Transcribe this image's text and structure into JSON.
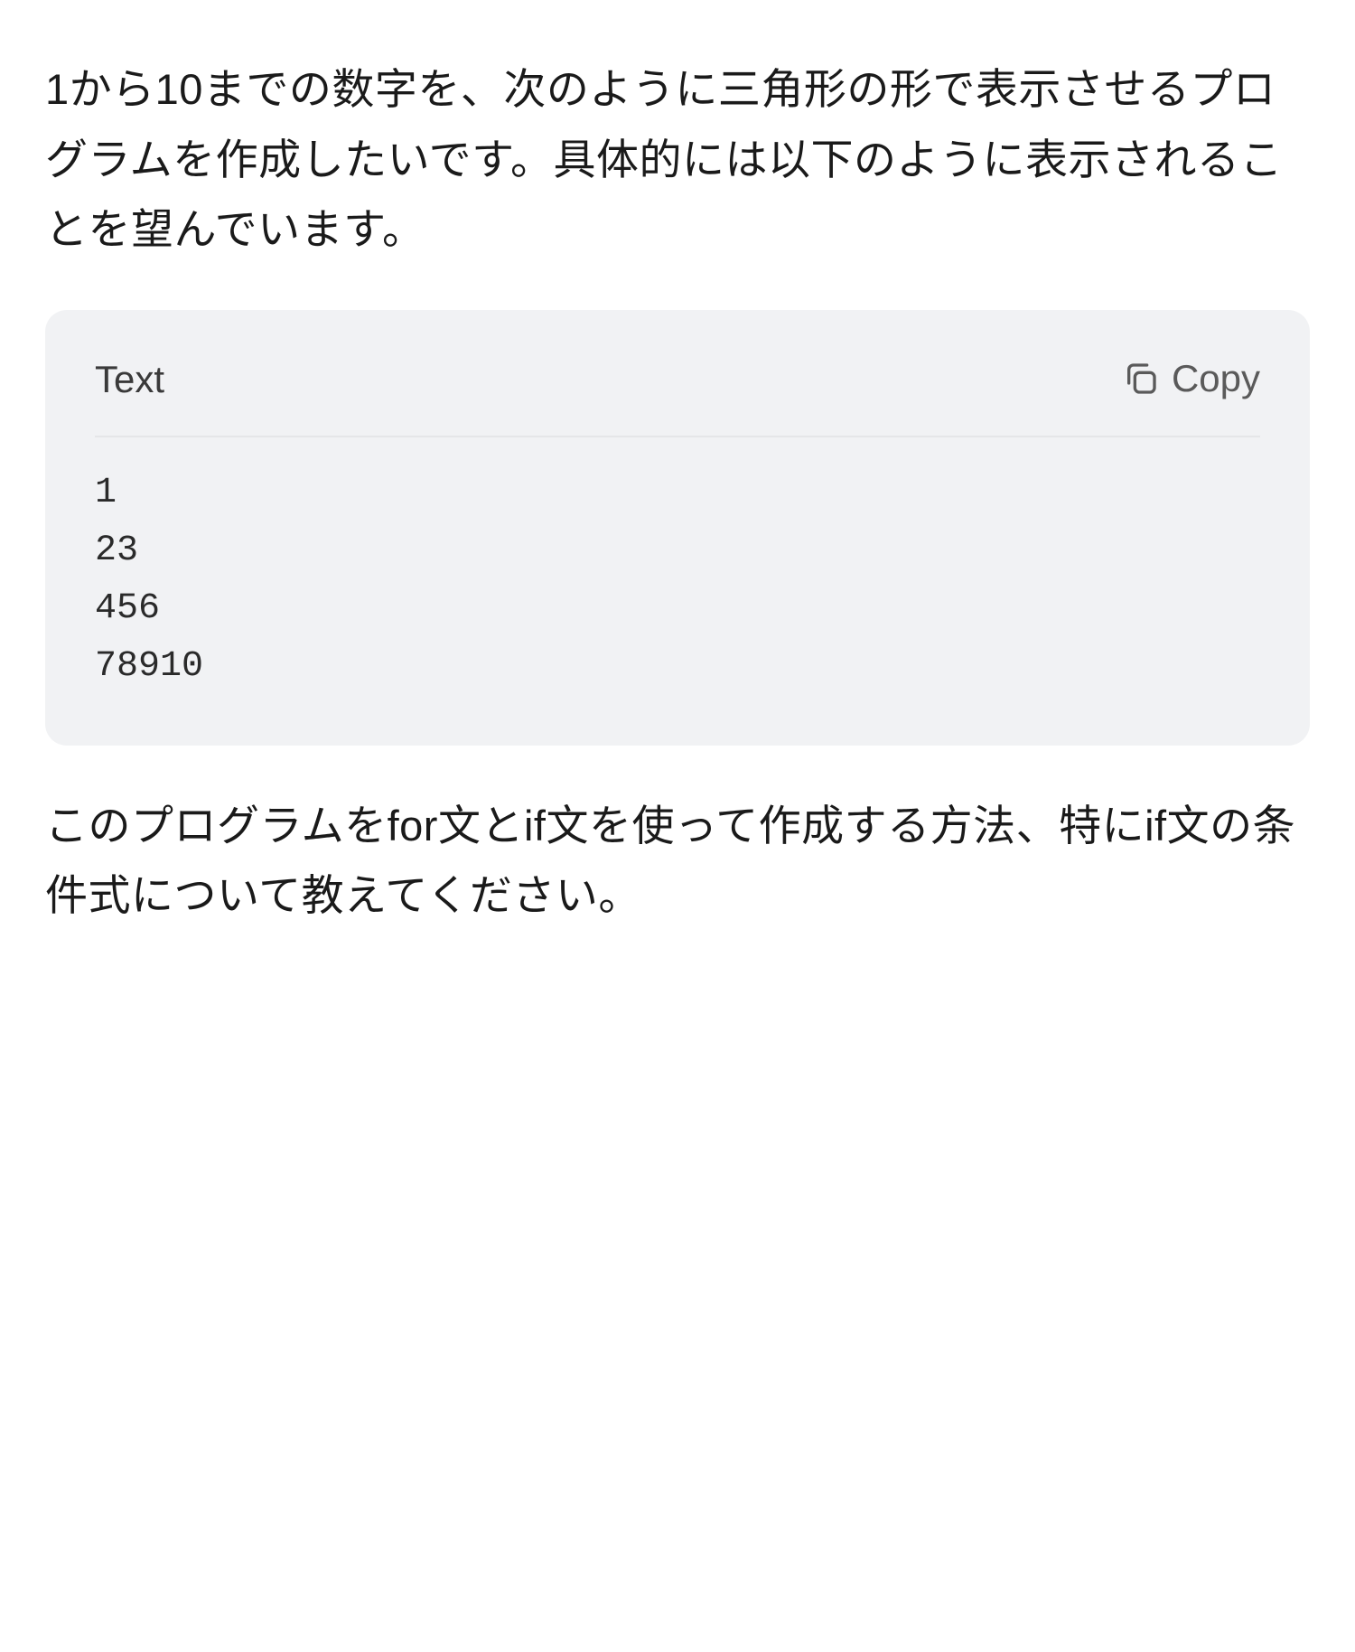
{
  "paragraph1": "1から10までの数字を、次のように三角形の形で表示させるプログラムを作成したいです。具体的には以下のように表示されることを望んでいます。",
  "codeBlock": {
    "language": "Text",
    "copyLabel": "Copy",
    "content": "1\n23\n456\n78910"
  },
  "paragraph2": "このプログラムをfor文とif文を使って作成する方法、特にif文の条件式について教えてください。"
}
